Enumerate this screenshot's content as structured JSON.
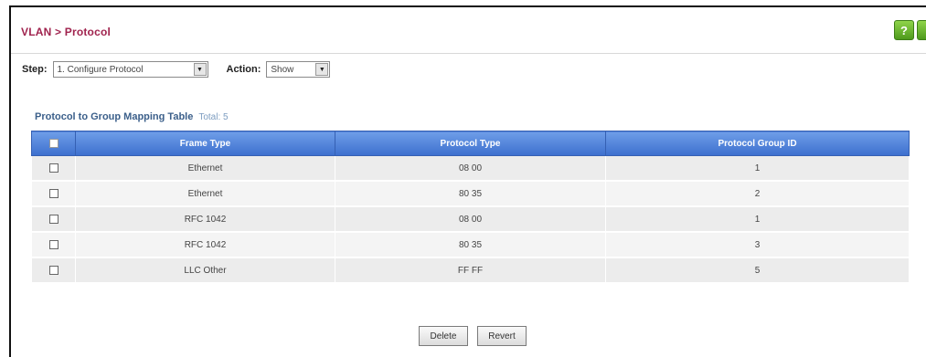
{
  "header": {
    "title": "VLAN > Protocol",
    "help_icon_glyph": "?"
  },
  "form": {
    "step_label": "Step:",
    "step_value": "1. Configure Protocol",
    "action_label": "Action:",
    "action_value": "Show"
  },
  "table": {
    "caption": "Protocol to Group Mapping Table",
    "total": "Total: 5",
    "columns": [
      "Frame Type",
      "Protocol Type",
      "Protocol Group ID"
    ],
    "rows": [
      {
        "frame_type": "Ethernet",
        "protocol_type": "08 00",
        "group_id": "1"
      },
      {
        "frame_type": "Ethernet",
        "protocol_type": "80 35",
        "group_id": "2"
      },
      {
        "frame_type": "RFC 1042",
        "protocol_type": "08 00",
        "group_id": "1"
      },
      {
        "frame_type": "RFC 1042",
        "protocol_type": "80 35",
        "group_id": "3"
      },
      {
        "frame_type": "LLC Other",
        "protocol_type": "FF FF",
        "group_id": "5"
      }
    ]
  },
  "buttons": {
    "delete": "Delete",
    "revert": "Revert"
  },
  "colors": {
    "title": "#a0234e",
    "header_bg": "#3c6fce",
    "row_bg": "#ececec",
    "icon_green": "#4e9a1c"
  }
}
